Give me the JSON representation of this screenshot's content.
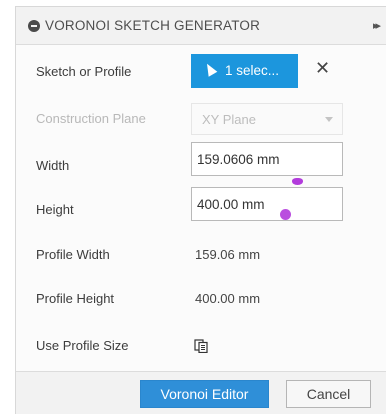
{
  "dialog": {
    "title": "VORONOI SKETCH GENERATOR",
    "expand_glyph": "▸▸"
  },
  "rows": {
    "sketch_or_profile": {
      "label": "Sketch or Profile",
      "selection_label": "1 selec...",
      "clear_glyph": "✕"
    },
    "construction_plane": {
      "label": "Construction Plane",
      "value": "XY Plane"
    },
    "width": {
      "label": "Width",
      "value": "159.0606 mm"
    },
    "height": {
      "label": "Height",
      "value": "400.00 mm"
    },
    "profile_width": {
      "label": "Profile Width",
      "value": "159.06 mm"
    },
    "profile_height": {
      "label": "Profile Height",
      "value": "400.00 mm"
    },
    "use_profile_size": {
      "label": "Use Profile Size"
    }
  },
  "footer": {
    "primary_label": "Voronoi Editor",
    "cancel_label": "Cancel"
  },
  "icons": {
    "title": "collapse-dot-icon",
    "selection": "cursor-arrow-icon",
    "clear": "close-icon",
    "dropdown": "chevron-down-icon",
    "profile_size": "copy-dimensions-icon",
    "expand": "double-chevron-right-icon"
  },
  "colors": {
    "select_button": "#1c96dd",
    "primary_button": "#2f8fd8",
    "manipulator_handle": "#b23bdc",
    "disabled_text": "#b8b8b8"
  }
}
